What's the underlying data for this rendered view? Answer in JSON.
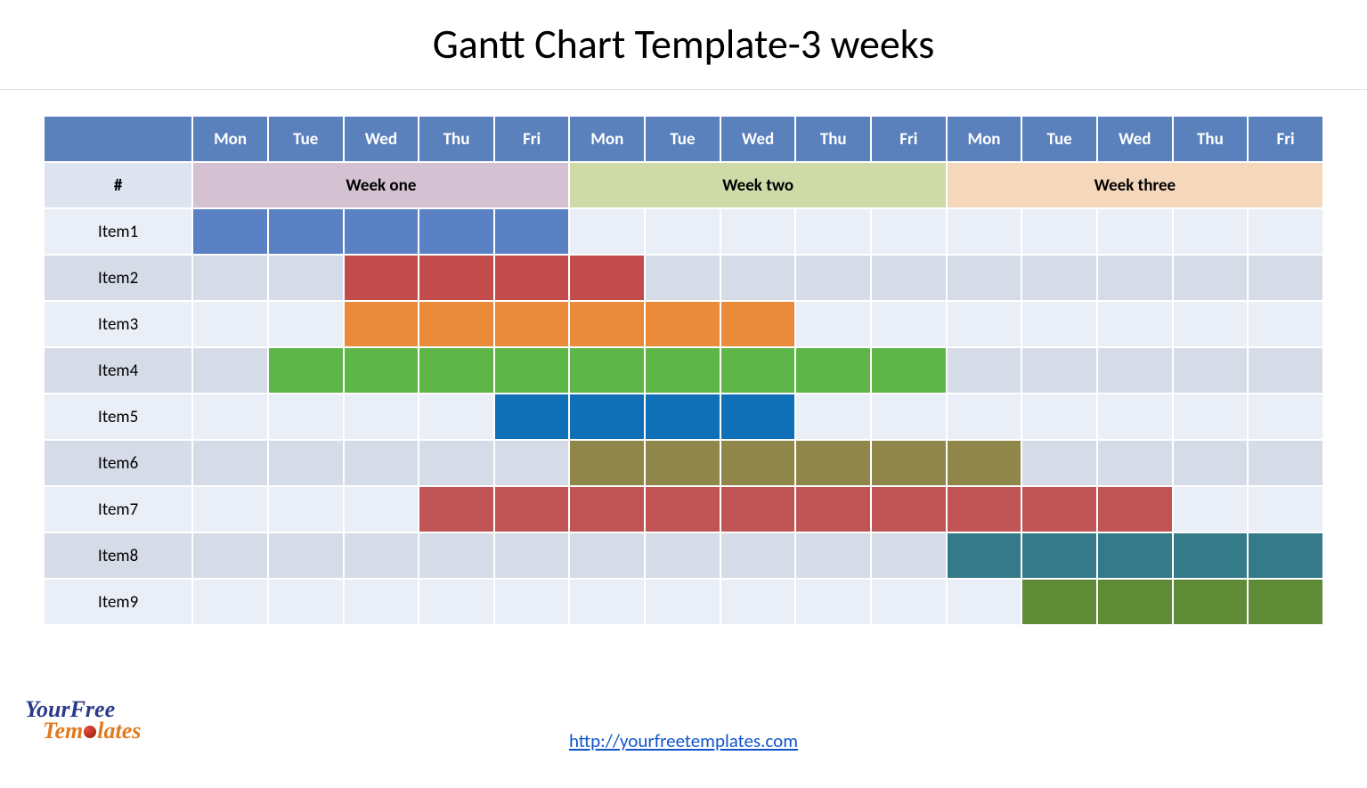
{
  "title": "Gantt Chart Template-3 weeks",
  "hash_label": "#",
  "days": [
    "Mon",
    "Tue",
    "Wed",
    "Thu",
    "Fri",
    "Mon",
    "Tue",
    "Wed",
    "Thu",
    "Fri",
    "Mon",
    "Tue",
    "Wed",
    "Thu",
    "Fri"
  ],
  "weeks": [
    {
      "label": "Week one",
      "span": 5,
      "cls": "wk1"
    },
    {
      "label": "Week two",
      "span": 5,
      "cls": "wk2"
    },
    {
      "label": "Week three",
      "span": 5,
      "cls": "wk3"
    }
  ],
  "items": [
    {
      "label": "Item1",
      "start": 0,
      "end": 4,
      "color": "#5a81c4"
    },
    {
      "label": "Item2",
      "start": 2,
      "end": 5,
      "color": "#c24c4c"
    },
    {
      "label": "Item3",
      "start": 2,
      "end": 7,
      "color": "#e98b3a"
    },
    {
      "label": "Item4",
      "start": 1,
      "end": 9,
      "color": "#5fb648"
    },
    {
      "label": "Item5",
      "start": 4,
      "end": 7,
      "color": "#0f70b7"
    },
    {
      "label": "Item6",
      "start": 5,
      "end": 10,
      "color": "#8f8749"
    },
    {
      "label": "Item7",
      "start": 3,
      "end": 12,
      "color": "#c05353"
    },
    {
      "label": "Item8",
      "start": 10,
      "end": 14,
      "color": "#347a88"
    },
    {
      "label": "Item9",
      "start": 11,
      "end": 14,
      "color": "#5f8a36"
    }
  ],
  "footer_url_text": "http://yourfreetemplates.com",
  "logo_line1": "YourFree",
  "logo_line2_a": "Tem",
  "logo_line2_b": "lates",
  "chart_data": {
    "type": "bar",
    "title": "Gantt Chart Template-3 weeks",
    "categories": [
      "Item1",
      "Item2",
      "Item3",
      "Item4",
      "Item5",
      "Item6",
      "Item7",
      "Item8",
      "Item9"
    ],
    "x_days": [
      "Mon",
      "Tue",
      "Wed",
      "Thu",
      "Fri",
      "Mon",
      "Tue",
      "Wed",
      "Thu",
      "Fri",
      "Mon",
      "Tue",
      "Wed",
      "Thu",
      "Fri"
    ],
    "week_groups": [
      "Week one",
      "Week one",
      "Week one",
      "Week one",
      "Week one",
      "Week two",
      "Week two",
      "Week two",
      "Week two",
      "Week two",
      "Week three",
      "Week three",
      "Week three",
      "Week three",
      "Week three"
    ],
    "series": [
      {
        "name": "Item1",
        "start_day_index": 0,
        "end_day_index": 4,
        "duration_days": 5,
        "color": "#5a81c4"
      },
      {
        "name": "Item2",
        "start_day_index": 2,
        "end_day_index": 5,
        "duration_days": 4,
        "color": "#c24c4c"
      },
      {
        "name": "Item3",
        "start_day_index": 2,
        "end_day_index": 7,
        "duration_days": 6,
        "color": "#e98b3a"
      },
      {
        "name": "Item4",
        "start_day_index": 1,
        "end_day_index": 9,
        "duration_days": 9,
        "color": "#5fb648"
      },
      {
        "name": "Item5",
        "start_day_index": 4,
        "end_day_index": 7,
        "duration_days": 4,
        "color": "#0f70b7"
      },
      {
        "name": "Item6",
        "start_day_index": 5,
        "end_day_index": 10,
        "duration_days": 6,
        "color": "#8f8749"
      },
      {
        "name": "Item7",
        "start_day_index": 3,
        "end_day_index": 12,
        "duration_days": 10,
        "color": "#c05353"
      },
      {
        "name": "Item8",
        "start_day_index": 10,
        "end_day_index": 14,
        "duration_days": 5,
        "color": "#347a88"
      },
      {
        "name": "Item9",
        "start_day_index": 11,
        "end_day_index": 14,
        "duration_days": 4,
        "color": "#5f8a36"
      }
    ],
    "xlabel": "",
    "ylabel": "",
    "xlim": [
      0,
      15
    ]
  }
}
